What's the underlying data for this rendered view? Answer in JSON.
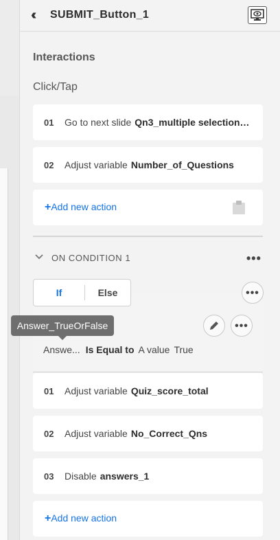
{
  "header": {
    "collapse_icon": "double-chevron-left-icon",
    "title": "SUBMIT_Button_1",
    "preview_icon": "preview-monitor-icon"
  },
  "interactions": {
    "section_title": "Interactions",
    "trigger": "Click/Tap",
    "actions": [
      {
        "num": "01",
        "verb": "Go to next slide",
        "target": "Qn3_multiple selection t..."
      },
      {
        "num": "02",
        "verb": "Adjust variable",
        "target": "Number_of_Questions"
      }
    ],
    "add_action_label": "Add new action",
    "add_plus": "+"
  },
  "condition": {
    "title": "ON CONDITION 1",
    "if_label": "If",
    "else_label": "Else",
    "expression": {
      "variable": "Answe...",
      "operator": "Is Equal to",
      "value_type": "A value",
      "value": "True"
    },
    "tooltip": "Answer_TrueOrFalse",
    "actions": [
      {
        "num": "01",
        "verb": "Adjust variable",
        "target": "Quiz_score_total"
      },
      {
        "num": "02",
        "verb": "Adjust variable",
        "target": "No_Correct_Qns"
      },
      {
        "num": "03",
        "verb": "Disable",
        "target": "answers_1"
      }
    ],
    "add_action_label": "Add new action",
    "add_plus": "+"
  },
  "colors": {
    "accent": "#1473e6",
    "panel_bg": "#f3f3f3",
    "card_bg": "#ffffff",
    "tooltip_bg": "#6e6e6e"
  }
}
